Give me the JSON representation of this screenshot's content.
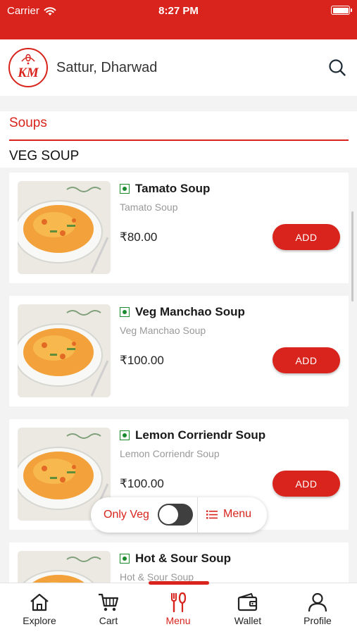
{
  "status_bar": {
    "carrier": "Carrier",
    "time": "8:27 PM"
  },
  "header": {
    "logo_text": "KM",
    "location": "Sattur, Dharwad"
  },
  "section": {
    "title": "Soups",
    "subsection": "VEG SOUP"
  },
  "items": [
    {
      "name": "Tamato Soup",
      "description": "Tamato Soup",
      "price": "₹80.00",
      "add_label": "ADD"
    },
    {
      "name": "Veg Manchao Soup",
      "description": "Veg Manchao Soup",
      "price": "₹100.00",
      "add_label": "ADD"
    },
    {
      "name": "Lemon Corriendr Soup",
      "description": "Lemon Corriendr Soup",
      "price": "₹100.00",
      "add_label": "ADD"
    },
    {
      "name": "Hot & Sour Soup",
      "description": "Hot & Sour Soup",
      "price": "",
      "add_label": ""
    }
  ],
  "filter": {
    "veg_label": "Only Veg",
    "veg_only": false,
    "menu_label": "Menu"
  },
  "tabs": [
    {
      "label": "Explore",
      "icon": "home-icon"
    },
    {
      "label": "Cart",
      "icon": "cart-icon"
    },
    {
      "label": "Menu",
      "icon": "fork-knife-icon",
      "active": true
    },
    {
      "label": "Wallet",
      "icon": "wallet-icon"
    },
    {
      "label": "Profile",
      "icon": "person-icon"
    }
  ],
  "colors": {
    "brand": "#d8241c",
    "veg": "#1a8a2e",
    "background": "#f3f3f3"
  }
}
